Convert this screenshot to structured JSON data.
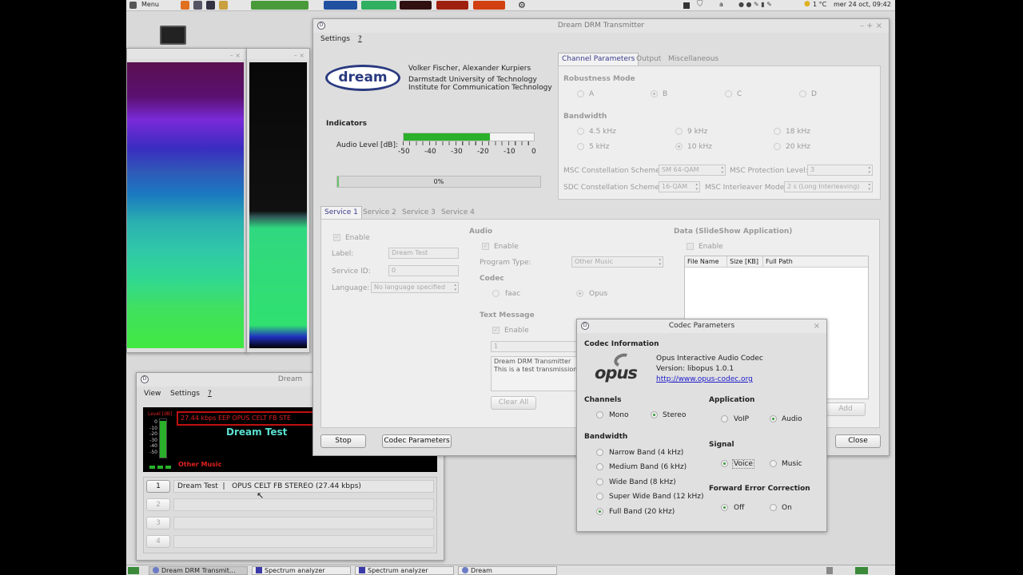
{
  "topbar": {
    "menu_label": "Menu",
    "weather": "1 °C",
    "clock": "mer 24 oct, 09:42"
  },
  "transmitter": {
    "title": "Dream DRM Transmitter",
    "menu": [
      "Settings",
      "?"
    ],
    "credits": [
      "Volker Fischer, Alexander Kurpiers",
      "Darmstadt University of Technology",
      "Institute for Communication Technology"
    ],
    "logo_text": "dream",
    "indicators_label": "Indicators",
    "audio_level_label": "Audio Level [dB]:",
    "audio_level_fraction": 0.66,
    "scale": [
      "-50",
      "-40",
      "-30",
      "-20",
      "-10",
      "0"
    ],
    "progress_text": "0%",
    "progress_fraction": 0.0,
    "tabs": [
      "Channel Parameters",
      "Output",
      "Miscellaneous"
    ],
    "robustness": {
      "label": "Robustness Mode",
      "options": [
        "A",
        "B",
        "C",
        "D"
      ],
      "selected": "B"
    },
    "bandwidth": {
      "label": "Bandwidth",
      "options": [
        "4.5 kHz",
        "9 kHz",
        "18 kHz",
        "5 kHz",
        "10 kHz",
        "20 kHz"
      ],
      "selected": "10 kHz"
    },
    "msc_constellation_label": "MSC Constellation Scheme:",
    "msc_constellation_value": "SM 64-QAM",
    "msc_protection_label": "MSC Protection Level:",
    "msc_protection_value": "3",
    "sdc_constellation_label": "SDC Constellation Scheme:",
    "sdc_constellation_value": "16-QAM",
    "msc_interleaver_label": "MSC Interleaver Mode:",
    "msc_interleaver_value": "2 s (Long Interleaving)",
    "service_tabs": [
      "Service 1",
      "Service 2",
      "Service 3",
      "Service 4"
    ],
    "service": {
      "enable": "Enable",
      "label_label": "Label:",
      "label_value": "Dream Test",
      "service_id_label": "Service ID:",
      "service_id_value": "0",
      "language_label": "Language:",
      "language_value": "No language specified"
    },
    "audio": {
      "header": "Audio",
      "enable": "Enable",
      "program_type_label": "Program Type:",
      "program_type_value": "Other Music",
      "codec_label": "Codec",
      "codec_faac": "faac",
      "codec_opus": "Opus",
      "text_message_label": "Text Message",
      "text_enable": "Enable",
      "text_index": "1",
      "text_lines": [
        "Dream DRM Transmitter",
        "This is a test transmission"
      ],
      "clear_all": "Clear All"
    },
    "data": {
      "header": "Data (SlideShow Application)",
      "enable": "Enable",
      "columns": [
        "File Name",
        "Size [KB]",
        "Full Path"
      ],
      "add": "Add"
    },
    "stop": "Stop",
    "codec_params": "Codec Parameters",
    "close": "Close"
  },
  "codec": {
    "title": "Codec Parameters",
    "info_header": "Codec Information",
    "logo_text": "opus",
    "info_lines": [
      "Opus Interactive Audio Codec",
      "Version: libopus 1.0.1"
    ],
    "link": "http://www.opus-codec.org",
    "channels": {
      "label": "Channels",
      "options": [
        "Mono",
        "Stereo"
      ],
      "selected": "Stereo"
    },
    "application": {
      "label": "Application",
      "options": [
        "VoIP",
        "Audio"
      ],
      "selected": "Audio"
    },
    "bandwidth": {
      "label": "Bandwidth",
      "options": [
        "Narrow Band (4 kHz)",
        "Medium Band (6 kHz)",
        "Wide Band (8 kHz)",
        "Super Wide Band (12 kHz)",
        "Full Band (20 kHz)"
      ],
      "selected": "Full Band (20 kHz)"
    },
    "signal": {
      "label": "Signal",
      "options": [
        "Voice",
        "Music"
      ],
      "selected": "Voice"
    },
    "fec": {
      "label": "Forward Error Correction",
      "options": [
        "Off",
        "On"
      ],
      "selected": "Off"
    }
  },
  "receiver": {
    "title": "Dream",
    "menu": [
      "View",
      "Settings",
      "?"
    ],
    "level_label": "Level [dB]",
    "level_scale": [
      "0",
      "-10",
      "-20",
      "-30",
      "-40",
      "-50"
    ],
    "status_line": "27.44 kbps EEP  OPUS CELT FB  STE",
    "station": "Dream Test",
    "genre": "Other Music",
    "services": [
      {
        "num": "1",
        "text": "Dream Test  |   OPUS CELT FB STEREO (27.44 kbps)"
      },
      {
        "num": "2",
        "text": ""
      },
      {
        "num": "3",
        "text": ""
      },
      {
        "num": "4",
        "text": ""
      }
    ]
  },
  "taskbar": [
    "Dream DRM Transmit...",
    "Spectrum analyzer",
    "Spectrum analyzer",
    "Dream"
  ]
}
